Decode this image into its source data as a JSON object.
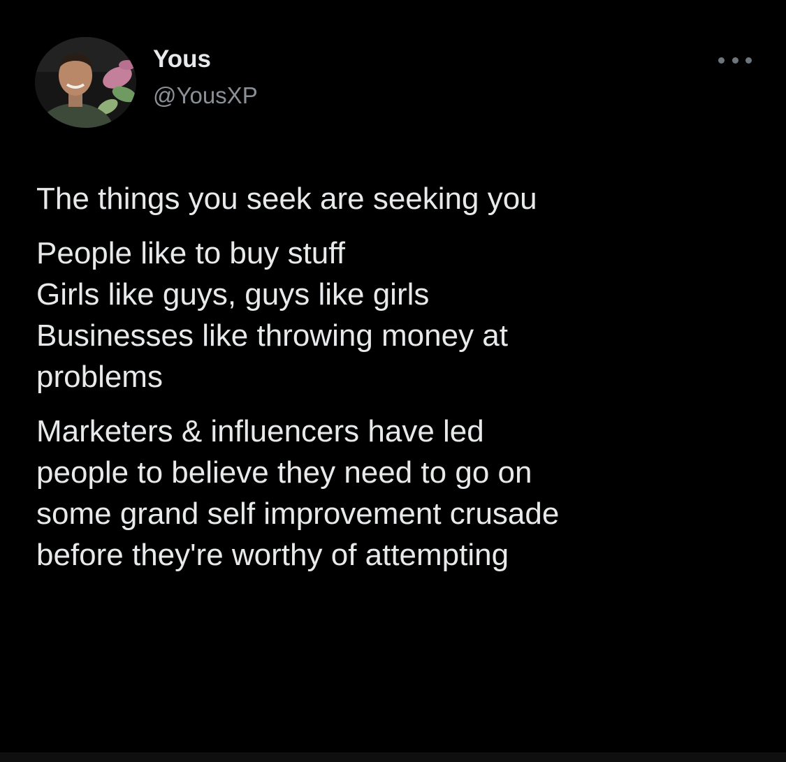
{
  "tweet": {
    "author": {
      "name": "Yous",
      "handle": "@YousXP",
      "avatar": "profile-photo"
    },
    "more_icon": "more-horizontal-icon",
    "paragraphs": [
      {
        "lines": [
          "The things you seek are seeking you"
        ]
      },
      {
        "lines": [
          "People like to buy stuff",
          "Girls like guys, guys like girls",
          "Businesses like throwing money at",
          "problems"
        ]
      },
      {
        "lines": [
          "Marketers & influencers have led",
          "people to believe they need to go on",
          "some grand self improvement crusade",
          "before they're worthy of attempting"
        ]
      }
    ]
  },
  "colors": {
    "background": "#000000",
    "primary_text": "#e7e9ea",
    "secondary_text": "#8b9096",
    "icon": "#6e767d"
  }
}
